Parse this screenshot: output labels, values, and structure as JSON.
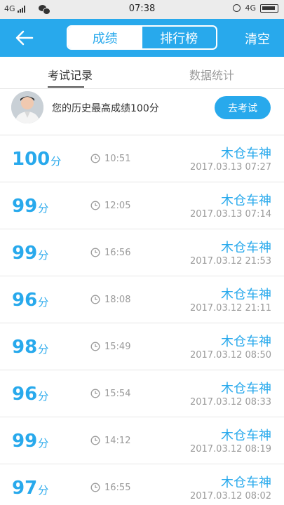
{
  "status_bar": {
    "left_network": "4G",
    "time": "07:38",
    "right_network": "4G"
  },
  "header": {
    "tabs": [
      {
        "label": "成绩",
        "active": true
      },
      {
        "label": "排行榜",
        "active": false
      }
    ],
    "clear_label": "清空",
    "accent_color": "#28a9ec"
  },
  "sub_tabs": [
    {
      "label": "考试记录",
      "active": true
    },
    {
      "label": "数据统计",
      "active": false
    }
  ],
  "best": {
    "text": "您的历史最高成绩100分",
    "button": "去考试"
  },
  "records": [
    {
      "score": "100",
      "unit": "分",
      "duration": "10:51",
      "user": "木仓车神",
      "date": "2017.03.13  07:27"
    },
    {
      "score": "99",
      "unit": "分",
      "duration": "12:05",
      "user": "木仓车神",
      "date": "2017.03.13  07:14"
    },
    {
      "score": "99",
      "unit": "分",
      "duration": "16:56",
      "user": "木仓车神",
      "date": "2017.03.12  21:53"
    },
    {
      "score": "96",
      "unit": "分",
      "duration": "18:08",
      "user": "木仓车神",
      "date": "2017.03.12  21:11"
    },
    {
      "score": "98",
      "unit": "分",
      "duration": "15:49",
      "user": "木仓车神",
      "date": "2017.03.12  08:50"
    },
    {
      "score": "96",
      "unit": "分",
      "duration": "15:54",
      "user": "木仓车神",
      "date": "2017.03.12  08:33"
    },
    {
      "score": "99",
      "unit": "分",
      "duration": "14:12",
      "user": "木仓车神",
      "date": "2017.03.12  08:19"
    },
    {
      "score": "97",
      "unit": "分",
      "duration": "16:55",
      "user": "木仓车神",
      "date": "2017.03.12  08:02"
    }
  ]
}
